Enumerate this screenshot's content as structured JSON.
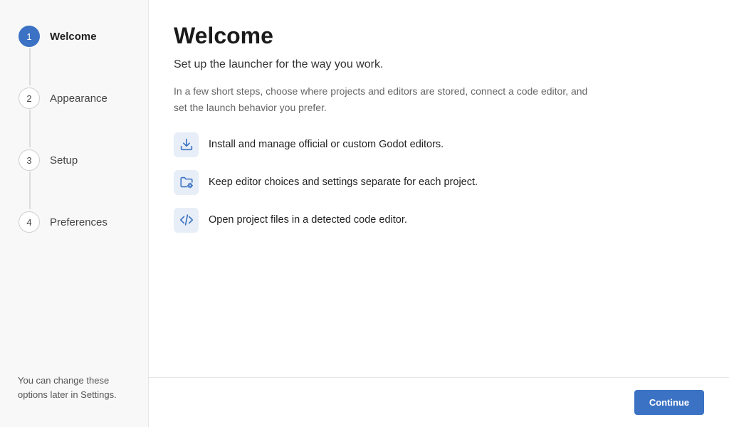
{
  "sidebar": {
    "steps": [
      {
        "number": "1",
        "label": "Welcome",
        "active": true
      },
      {
        "number": "2",
        "label": "Appearance",
        "active": false
      },
      {
        "number": "3",
        "label": "Setup",
        "active": false
      },
      {
        "number": "4",
        "label": "Preferences",
        "active": false
      }
    ],
    "note": "You can change these options later in Settings."
  },
  "main": {
    "title": "Welcome",
    "subtitle": "Set up the launcher for the way you work.",
    "description": "In a few short steps, choose where projects and editors are stored, connect a code editor, and set the launch behavior you prefer.",
    "features": [
      {
        "icon": "download-icon",
        "text": "Install and manage official or custom Godot editors."
      },
      {
        "icon": "folder-settings-icon",
        "text": "Keep editor choices and settings separate for each project."
      },
      {
        "icon": "code-icon",
        "text": "Open project files in a detected code editor."
      }
    ]
  },
  "footer": {
    "continue_label": "Continue"
  },
  "colors": {
    "accent": "#3b72c4",
    "icon_bg": "#e8eef7",
    "sidebar_bg": "#f8f8f8"
  }
}
